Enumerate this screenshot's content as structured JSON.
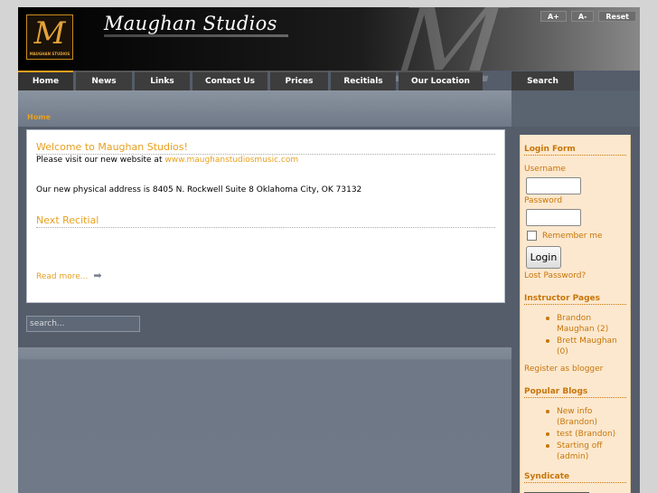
{
  "header": {
    "logo_letter": "M",
    "logo_caption": "MAUGHAN STUDIOS",
    "site_title": "Maughan Studios",
    "bg_letter": "M",
    "font_controls": [
      "A+",
      "A-",
      "Reset"
    ]
  },
  "nav": {
    "items": [
      {
        "label": "Home",
        "active": true
      },
      {
        "label": "News"
      },
      {
        "label": "Links"
      },
      {
        "label": "Contact Us"
      },
      {
        "label": "Prices"
      },
      {
        "label": "Recitials"
      },
      {
        "label": "Our Location"
      }
    ],
    "search_tab": "Search"
  },
  "breadcrumb": "Home",
  "content": {
    "welcome_title": "Welcome to Maughan Studios!",
    "visit_text": "Please visit our new website at",
    "visit_link": "www.maughanstudiosmusic.com",
    "address": "Our new physical address is  8405 N. Rockwell Suite 8 Oklahoma City, OK 73132",
    "next_title": "Next Recitial",
    "read_more": "Read more..."
  },
  "search": {
    "placeholder": "search..."
  },
  "sidebar": {
    "login": {
      "title": "Login Form",
      "username_label": "Username",
      "password_label": "Password",
      "remember_label": "Remember me",
      "button": "Login",
      "lost_password": "Lost Password?"
    },
    "instructor": {
      "title": "Instructor Pages",
      "items": [
        "Brandon Maughan (2)",
        "Brett Maughan (0)"
      ]
    },
    "register": "Register as blogger",
    "popular": {
      "title": "Popular Blogs",
      "items": [
        "New info (Brandon)",
        "test (Brandon)",
        "Starting off (admin)"
      ]
    },
    "syndicate": {
      "title": "Syndicate"
    }
  },
  "colors": {
    "accent": "#e8a020",
    "sidebar_bg": "#fce8ce",
    "nav_bg": "#3d3d3d"
  }
}
